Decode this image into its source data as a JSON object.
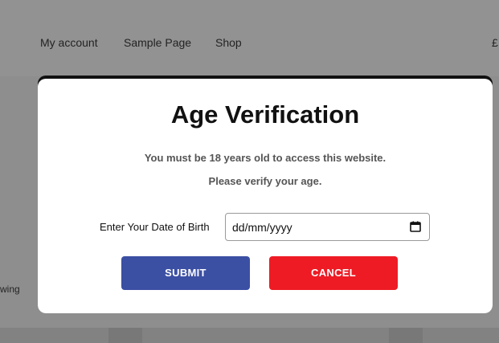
{
  "nav": {
    "items": [
      "My account",
      "Sample Page",
      "Shop"
    ],
    "cart_fragment": "£"
  },
  "background": {
    "side_text_fragment": "wing"
  },
  "modal": {
    "title": "Age Verification",
    "message_line_1": "You must be 18 years old to access this website.",
    "message_line_2": "Please verify your age.",
    "dob_label": "Enter Your Date of Birth",
    "dob_value": "dd/mm/yyyy",
    "submit_label": "SUBMIT",
    "cancel_label": "CANCEL"
  },
  "colors": {
    "submit": "#3b4fa3",
    "cancel": "#ee1b24"
  },
  "icons": {
    "date_picker": "calendar-icon"
  }
}
